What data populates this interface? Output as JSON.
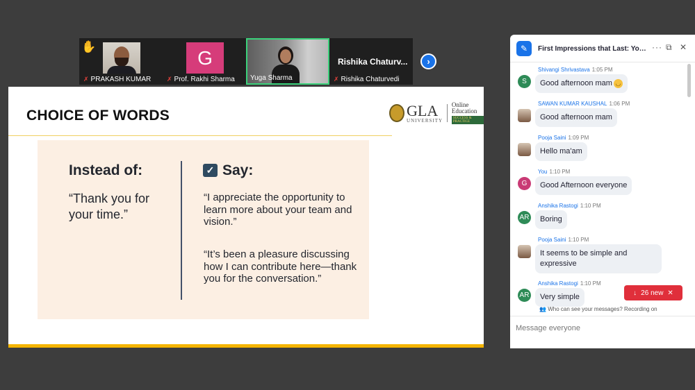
{
  "participants": [
    {
      "name": "PRAKASH KUMAR",
      "muted": true,
      "avatar": "photo"
    },
    {
      "name": "Prof. Rakhi Sharma",
      "muted": true,
      "avatar": "G"
    },
    {
      "name": "Yuga Sharma",
      "muted": false,
      "avatar": "photo",
      "active_speaker": true
    },
    {
      "name": "Rishika Chaturvedi",
      "display": "Rishika  Chaturv...",
      "muted": true
    }
  ],
  "strip": {
    "raise_hand_icon": "raised-hand-icon",
    "next_icon": "chevron-right-icon"
  },
  "slide": {
    "title": "CHOICE OF WORDS",
    "logo": {
      "main": "GLA",
      "sub": "UNIVERSITY",
      "line1": "Online",
      "line2": "Education",
      "tag": "SUCCESS & PRACTICE"
    },
    "instead": {
      "heading": "Instead of:",
      "quote": "“Thank you for your time.”"
    },
    "say": {
      "heading": "Say:",
      "quotes": [
        "“I appreciate the opportunity to learn more about your team and vision.”",
        "“It’s been a pleasure discussing how I can contribute here—thank you for the conversation.”"
      ]
    }
  },
  "chat": {
    "title": "First Impressions that Last: Your...",
    "messages": [
      {
        "sender": "Shivangi Shrivastava",
        "time": "1:05 PM",
        "text": "Good afternoon mam",
        "emoji": true,
        "avatar": "S"
      },
      {
        "sender": "SAWAN KUMAR KAUSHAL",
        "time": "1:06 PM",
        "text": "Good afternoon mam",
        "avatar": "photo"
      },
      {
        "sender": "Pooja Saini",
        "time": "1:09 PM",
        "text": "Hello ma'am",
        "avatar": "photo"
      },
      {
        "sender": "You",
        "time": "1:10 PM",
        "text": "Good Afternoon everyone",
        "avatar": "G"
      },
      {
        "sender": "Anshika Rastogi",
        "time": "1:10 PM",
        "text": "Boring",
        "avatar": "AR"
      },
      {
        "sender": "Pooja Saini",
        "time": "1:10 PM",
        "text": "It seems to be simple and expressive",
        "avatar": "photo"
      },
      {
        "sender": "Anshika Rastogi",
        "time": "1:10 PM",
        "text": "Very simple",
        "avatar": "AR"
      }
    ],
    "new_count_label": "26 new",
    "visibility_note": "Who can see your messages? Recording on",
    "input_placeholder": "Message everyone",
    "input_value": ""
  }
}
